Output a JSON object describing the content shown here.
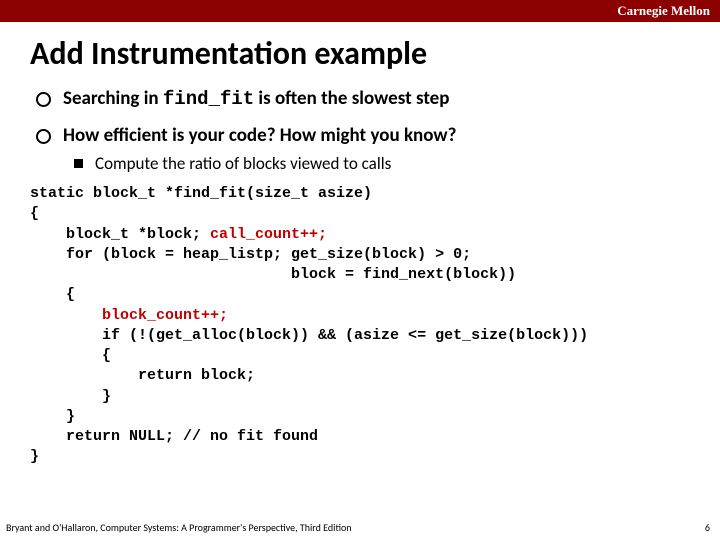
{
  "header": {
    "brand": "Carnegie Mellon"
  },
  "title": "Add Instrumentation example",
  "bullets": {
    "b1a_pre": "Searching in ",
    "b1a_code": "find_fit",
    "b1a_post": " is often the slowest step",
    "b1b": "How efficient is your code?  How might you know?",
    "b2a": "Compute the ratio of blocks viewed to calls"
  },
  "code": {
    "l1": "static block_t *find_fit(size_t asize)",
    "l2": "{",
    "l3a": "    block_t *block; ",
    "l3b": "call_count++;",
    "l4": "    for (block = heap_listp; get_size(block) > 0;",
    "l5": "                             block = find_next(block))",
    "l6": "    {",
    "l7": "        block_count++;",
    "l8": "        if (!(get_alloc(block)) && (asize <= get_size(block)))",
    "l9": "        {",
    "l10": "            return block;",
    "l11": "        }",
    "l12": "    }",
    "l13": "    return NULL; // no fit found",
    "l14": "}"
  },
  "footer": {
    "attribution": "Bryant and O'Hallaron, Computer Systems: A Programmer's Perspective, Third Edition",
    "page": "6"
  }
}
